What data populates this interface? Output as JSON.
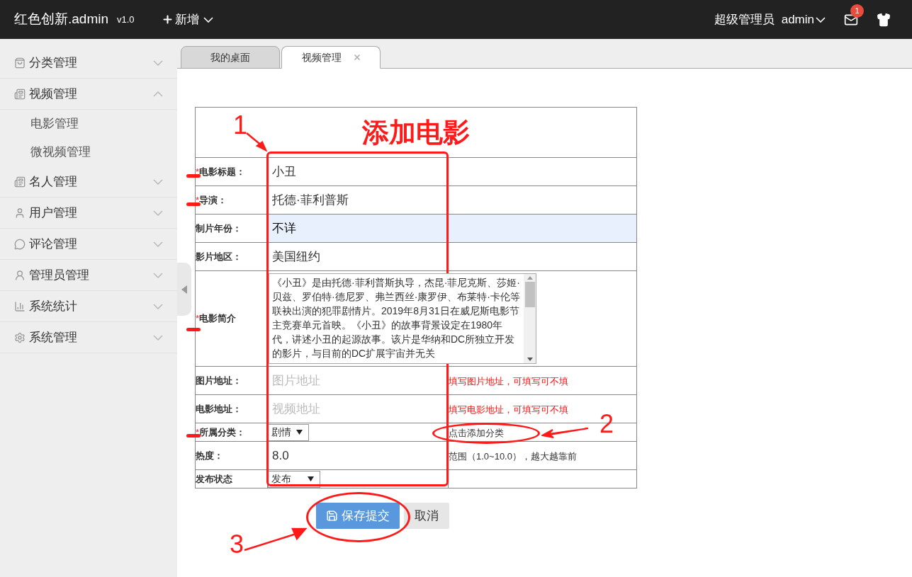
{
  "header": {
    "brand": "红色创新.admin",
    "version": "v1.0",
    "add_menu": "新增",
    "user_role": "超级管理员",
    "username": "admin",
    "mail_badge": "1"
  },
  "sidebar": {
    "items": [
      {
        "label": "分类管理",
        "expanded": false
      },
      {
        "label": "视频管理",
        "expanded": true,
        "children": [
          {
            "label": "电影管理"
          },
          {
            "label": "微视频管理"
          }
        ]
      },
      {
        "label": "名人管理",
        "expanded": false
      },
      {
        "label": "用户管理",
        "expanded": false
      },
      {
        "label": "评论管理",
        "expanded": false
      },
      {
        "label": "管理员管理",
        "expanded": false
      },
      {
        "label": "系统统计",
        "expanded": false
      },
      {
        "label": "系统管理",
        "expanded": false
      }
    ]
  },
  "tabs": [
    {
      "label": "我的桌面",
      "selected": false,
      "closable": false
    },
    {
      "label": "视频管理",
      "selected": true,
      "closable": true
    }
  ],
  "form": {
    "title": "添加电影",
    "required_mark": "*",
    "rows": [
      {
        "kind": "text",
        "label": "电影标题：",
        "required": true,
        "value": "小丑",
        "highlighted": false
      },
      {
        "kind": "text",
        "label": "导演：",
        "required": true,
        "value": "托德·菲利普斯",
        "highlighted": false
      },
      {
        "kind": "text",
        "label": "制片年份：",
        "required": false,
        "value": "不详",
        "highlighted": true
      },
      {
        "kind": "text",
        "label": "影片地区：",
        "required": false,
        "value": "美国纽约",
        "highlighted": false
      },
      {
        "kind": "textarea",
        "label": "电影简介",
        "required": true,
        "value": "《小丑》是由托德·菲利普斯执导，杰昆·菲尼克斯、莎姬·贝兹、罗伯特·德尼罗、弗兰西丝·康罗伊、布莱特·卡伦等联袂出演的犯罪剧情片。2019年8月31日在威尼斯电影节主竞赛单元首映。《小丑》的故事背景设定在1980年代，讲述小丑的起源故事。该片是华纳和DC所独立开发的影片，与目前的DC扩展宇宙并无关"
      },
      {
        "kind": "url",
        "label": "图片地址：",
        "required": false,
        "placeholder": "图片地址",
        "hint": "填写图片地址，可填写可不填"
      },
      {
        "kind": "url",
        "label": "电影地址：",
        "required": false,
        "placeholder": "视频地址",
        "hint": "填写电影地址，可填写可不填"
      },
      {
        "kind": "select",
        "label": "所属分类：",
        "required": true,
        "value": "剧情",
        "link": "点击添加分类"
      },
      {
        "kind": "number",
        "label": "热度：",
        "required": false,
        "value": "8.0",
        "hint": "范围（1.0~10.0），越大越靠前"
      },
      {
        "kind": "select",
        "label": "发布状态",
        "required": false,
        "value": "发布"
      }
    ]
  },
  "actions": [
    {
      "kind": "primary",
      "label": "保存提交"
    },
    {
      "kind": "secondary",
      "label": "取消"
    }
  ],
  "annotations": {
    "labels": [
      "1",
      "2",
      "3"
    ]
  }
}
